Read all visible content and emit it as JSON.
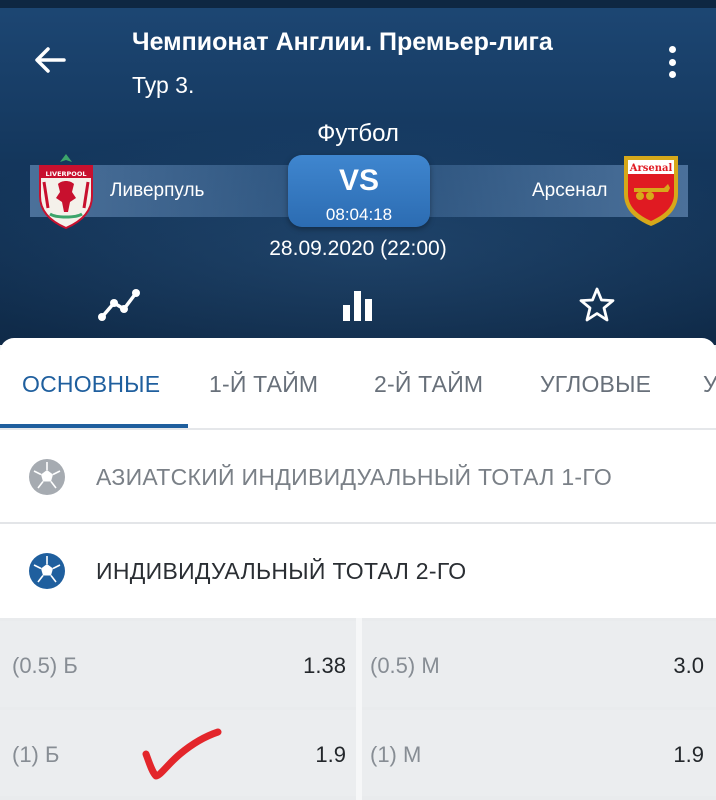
{
  "header": {
    "title": "Чемпионат Англии. Премьер-лига",
    "subtitle": "Тур 3.",
    "sport": "Футбол",
    "home_team": "Ливерпуль",
    "away_team": "Арсенал",
    "home_crest_text": "LIVERPOOL",
    "away_crest_text": "Arsenal",
    "vs": "VS",
    "timer": "08:04:18",
    "date": "28.09.2020 (22:00)",
    "icons": [
      "back-arrow-icon",
      "more-vert-icon",
      "stats-line-icon",
      "bar-chart-icon",
      "star-icon"
    ]
  },
  "tabs": [
    {
      "label": "ОСНОВНЫЕ",
      "active": true
    },
    {
      "label": "1-Й ТАЙМ",
      "active": false
    },
    {
      "label": "2-Й ТАЙМ",
      "active": false
    },
    {
      "label": "УГЛОВЫЕ",
      "active": false
    },
    {
      "label": "У",
      "active": false
    }
  ],
  "groups": [
    {
      "label": "АЗИАТСКИЙ ИНДИВИДУАЛЬНЫЙ ТОТАЛ 1-ГО",
      "icon": "soccer-ball-icon",
      "expanded": false
    },
    {
      "label": "ИНДИВИДУАЛЬНЫЙ ТОТАЛ 2-ГО",
      "icon": "soccer-ball-icon",
      "expanded": true
    }
  ],
  "odds": [
    [
      {
        "name": "(0.5) Б",
        "value": "1.38"
      },
      {
        "name": "(0.5) М",
        "value": "3.0"
      }
    ],
    [
      {
        "name": "(1) Б",
        "value": "1.9"
      },
      {
        "name": "(1) М",
        "value": "1.9"
      }
    ]
  ],
  "colors": {
    "header_bg": "#14375d",
    "accent": "#1f5f9e",
    "vs_box": "#3579c0",
    "checkmark": "#e3262b"
  }
}
